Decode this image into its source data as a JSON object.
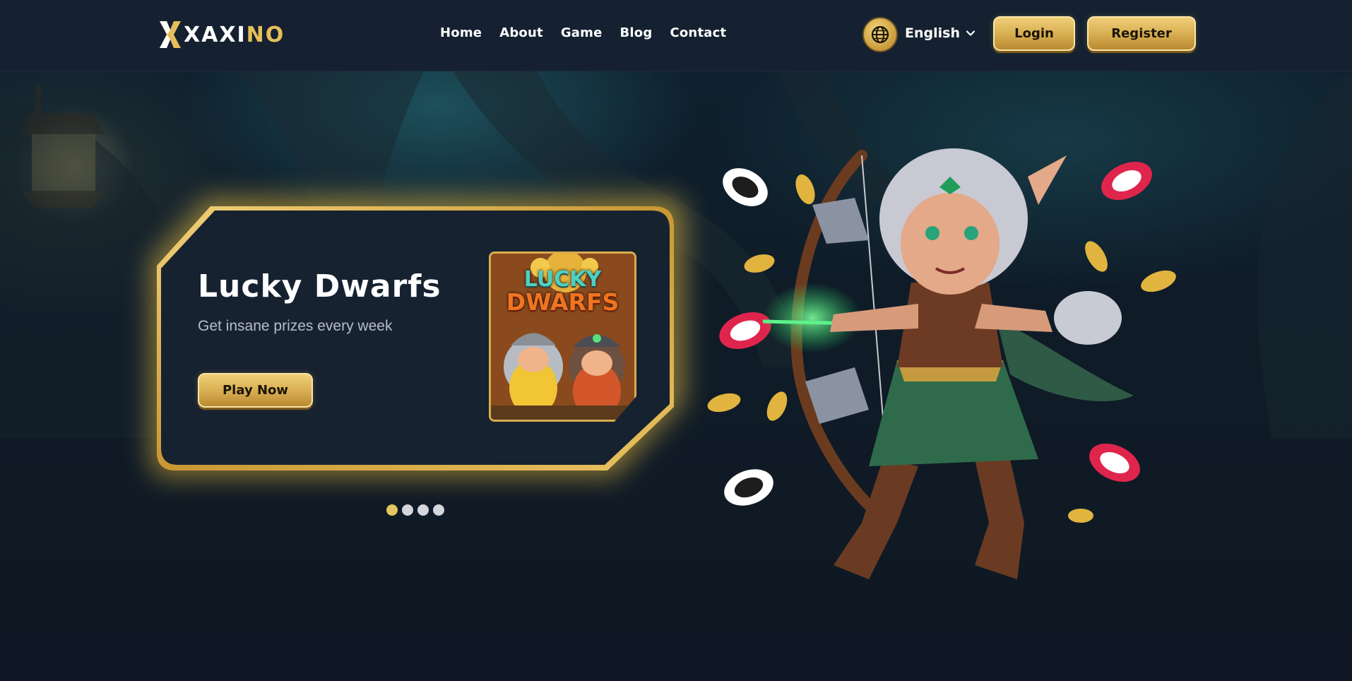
{
  "brand": {
    "logo_white": "XAXI",
    "logo_gold": "NO",
    "colors": {
      "gold": "#e6be5c",
      "bg": "#101a26",
      "header": "#152130"
    }
  },
  "nav": {
    "items": [
      {
        "label": "Home"
      },
      {
        "label": "About"
      },
      {
        "label": "Game"
      },
      {
        "label": "Blog"
      },
      {
        "label": "Contact"
      }
    ]
  },
  "header": {
    "globe_icon": "globe-icon",
    "language": "English",
    "login_label": "Login",
    "register_label": "Register"
  },
  "promo": {
    "title": "Lucky Dwarfs",
    "subtitle": "Get insane prizes every week",
    "cta_label": "Play Now",
    "thumb_line1": "LUCKY",
    "thumb_line2": "DWARFS"
  },
  "carousel": {
    "total": 4,
    "active_index": 0
  },
  "hero": {
    "icon": "elf-archer-illustration"
  }
}
